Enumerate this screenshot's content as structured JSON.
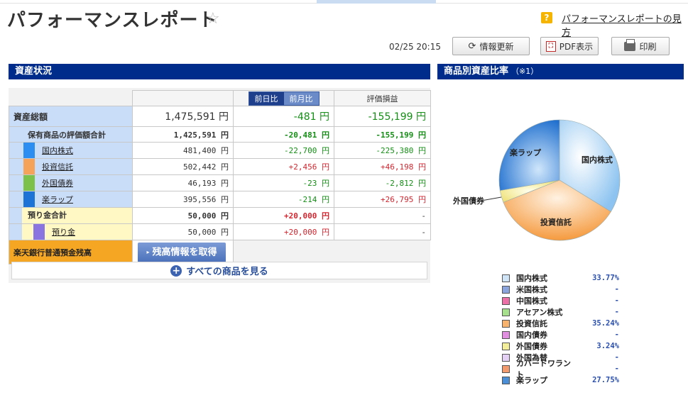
{
  "page_title": "パフォーマンスレポート",
  "help_link": "パフォーマンスレポートの見方",
  "help_icon_char": "?",
  "star_char": "☆",
  "toolbar": {
    "timestamp": "02/25 20:15",
    "refresh_label": "情報更新",
    "pdf_label": "PDF表示",
    "print_label": "印刷"
  },
  "assets_section": {
    "title": "資産状況",
    "headers": {
      "tab_day": "前日比",
      "tab_month": "前月比",
      "valuation": "評価損益"
    },
    "total": {
      "label": "資産総額",
      "amount": "1,475,591 円",
      "change": "-481 円",
      "pnl": "-155,199 円"
    },
    "holdings": {
      "label": "保有商品の評価額合計",
      "amount": "1,425,591 円",
      "change": "-20,481 円",
      "pnl": "-155,199 円"
    },
    "items": [
      {
        "label": "国内株式",
        "color": "#2b8ef0",
        "amount": "481,400 円",
        "change": "-22,700 円",
        "pnl": "-225,380 円"
      },
      {
        "label": "投資信託",
        "color": "#f5a35a",
        "amount": "502,442 円",
        "change": "+2,456 円",
        "pnl": "+46,198 円"
      },
      {
        "label": "外国債券",
        "color": "#7cc14a",
        "amount": "46,193 円",
        "change": "-23 円",
        "pnl": "-2,812 円"
      },
      {
        "label": "楽ラップ",
        "color": "#1d74d6",
        "amount": "395,556 円",
        "change": "-214 円",
        "pnl": "+26,795 円"
      }
    ],
    "deposit_total": {
      "label": "預り金合計",
      "amount": "50,000 円",
      "change": "+20,000 円",
      "pnl": "-"
    },
    "deposit": {
      "label": "預り金",
      "color": "#8a74e0",
      "amount": "50,000 円",
      "change": "+20,000 円",
      "pnl": "-"
    },
    "bank": {
      "label": "楽天銀行普通預金残高",
      "button": "残高情報を取得"
    },
    "all_products_label": "すべての商品を見る"
  },
  "allocation_section": {
    "title": "商品別資産比率",
    "note": "（※1）"
  },
  "chart_data": {
    "type": "pie",
    "title": "商品別資産比率",
    "slices": [
      {
        "label": "国内株式",
        "value": 33.77,
        "color": "#bcdcf6"
      },
      {
        "label": "投資信託",
        "value": 35.24,
        "color": "#f8b97c"
      },
      {
        "label": "外国債券",
        "value": 3.24,
        "color": "#f6f0a2"
      },
      {
        "label": "楽ラップ",
        "value": 27.75,
        "color": "#3a8ee0"
      }
    ],
    "legend": [
      {
        "label": "国内株式",
        "value": "33.77%",
        "color": "#cfe4f7"
      },
      {
        "label": "米国株式",
        "value": "-",
        "color": "#8aa4de"
      },
      {
        "label": "中国株式",
        "value": "-",
        "color": "#ec6fa8"
      },
      {
        "label": "アセアン株式",
        "value": "-",
        "color": "#a7e08c"
      },
      {
        "label": "投資信託",
        "value": "35.24%",
        "color": "#f7b36e"
      },
      {
        "label": "国内債券",
        "value": "-",
        "color": "#e28ee0"
      },
      {
        "label": "外国債券",
        "value": "3.24%",
        "color": "#f2ee9a"
      },
      {
        "label": "外国為替",
        "value": "-",
        "color": "#e4d0f4"
      },
      {
        "label": "カバードワラント",
        "value": "-",
        "color": "#f39a6e"
      },
      {
        "label": "楽ラップ",
        "value": "27.75%",
        "color": "#4a8ed8"
      }
    ],
    "legend_position": "bottom"
  }
}
